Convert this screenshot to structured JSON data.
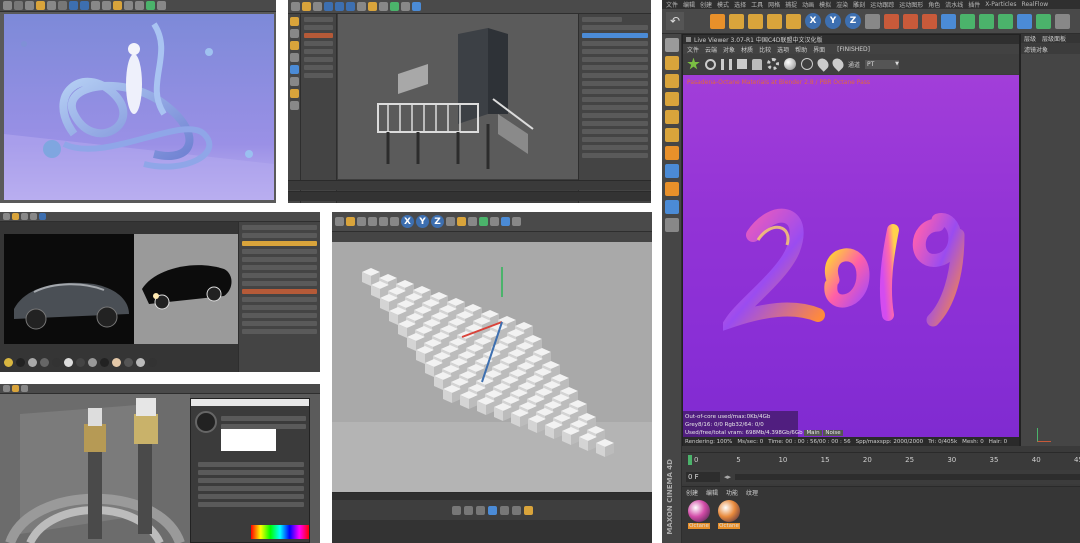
{
  "main_menu": [
    "文件",
    "编辑",
    "创建",
    "模式",
    "选择",
    "工具",
    "网格",
    "捕捉",
    "动画",
    "模拟",
    "渲染",
    "雕刻",
    "运动跟踪",
    "运动图形",
    "角色",
    "流水线",
    "插件",
    "X-Particles",
    "RealFlow"
  ],
  "axis_buttons": [
    "X",
    "Y",
    "Z"
  ],
  "live_viewer": {
    "title": "Live Viewer 3.07-R1 中国C4D联盟中文汉化版",
    "menu": [
      "文件",
      "云端",
      "对象",
      "材质",
      "比较",
      "选项",
      "帮助",
      "界面"
    ],
    "status_tag": "[FINISHED]",
    "mode_label": "通道",
    "mode_value": "PT",
    "top_caption": "Pasadena-Octane Materials at Blender 2.8 / PBR Octane Pass",
    "stats": {
      "line1": "Out-of-core used/max:0Kb/4Gb",
      "line2_a": "Grey8/16: 0/0",
      "line2_b": "Rgb32/64: 0/0",
      "line3_a": "Used/free/total vram: 698Mb/4.398Gb/6Gb",
      "line3_b": "Main",
      "line3_c": "Noise"
    },
    "render_bar": [
      "Rendering: 100%",
      "Ms/sec: 0",
      "Time: 00 : 00 : 56/00 : 00 : 56",
      "Spp/maxspp: 2000/2000",
      "Tri: 0/405k",
      "Mesh: 0",
      "Hair: 0"
    ]
  },
  "right_panel": {
    "tabs": [
      "层级",
      "层级面板"
    ],
    "sub_title": "滤镜对象"
  },
  "timeline_ticks": [
    "0",
    "5",
    "10",
    "15",
    "20",
    "25",
    "30",
    "35",
    "40",
    "45"
  ],
  "frame_field": "0 F",
  "material_menu": [
    "创建",
    "编辑",
    "功能",
    "纹理"
  ],
  "materials": [
    {
      "name": "Octane",
      "color": "#d24ca8"
    },
    {
      "name": "Octane",
      "color": "#e88a3c"
    }
  ],
  "brand_vertical": "MAXON CINEMA 4D",
  "render_artwork_text": "2019",
  "colors": {
    "viewport_purple": "#8a2fd6",
    "ui_gray": "#3c3c3c",
    "accent_orange": "#e8902a",
    "axis_blue": "#3d6fb0"
  },
  "thumbnails": [
    {
      "id": "dancer",
      "title": "ribbon-dancer-render"
    },
    {
      "id": "house",
      "title": "wooden-stilt-house-model"
    },
    {
      "id": "car",
      "title": "sports-car-render"
    },
    {
      "id": "cubes",
      "title": "cube-grid-cloner"
    },
    {
      "id": "cable",
      "title": "usb-cable-render"
    }
  ]
}
